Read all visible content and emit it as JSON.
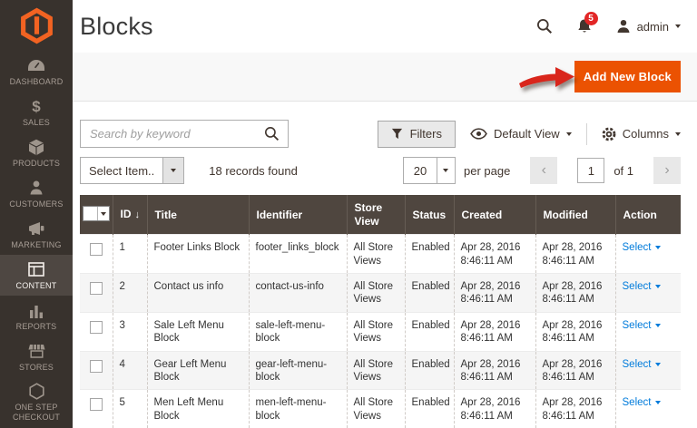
{
  "header": {
    "title": "Blocks",
    "notification_count": "5",
    "username": "admin"
  },
  "page_actions": {
    "add_new_block_label": "Add New Block"
  },
  "toolbar": {
    "search_placeholder": "Search by keyword",
    "filters_label": "Filters",
    "default_view_label": "Default View",
    "columns_label": "Columns"
  },
  "grid_controls": {
    "mass_action_label": "Select Item..",
    "records_found": "18 records found",
    "per_page_value": "20",
    "per_page_label": "per page",
    "prev_label": "‹",
    "next_label": "›",
    "current_page": "1",
    "of_pages": "of 1"
  },
  "table": {
    "header": {
      "id": "ID",
      "sort_indicator": "↓",
      "title": "Title",
      "identifier": "Identifier",
      "store_view": "Store View",
      "status": "Status",
      "created": "Created",
      "modified": "Modified",
      "action": "Action"
    },
    "rows": [
      {
        "id": "1",
        "title": "Footer Links Block",
        "identifier": "footer_links_block",
        "store_view": "All Store Views",
        "status": "Enabled",
        "created_date": "Apr 28, 2016",
        "created_time": "8:46:11 AM",
        "modified_date": "Apr 28, 2016",
        "modified_time": "8:46:11 AM",
        "action": "Select"
      },
      {
        "id": "2",
        "title": "Contact us info",
        "identifier": "contact-us-info",
        "store_view": "All Store Views",
        "status": "Enabled",
        "created_date": "Apr 28, 2016",
        "created_time": "8:46:11 AM",
        "modified_date": "Apr 28, 2016",
        "modified_time": "8:46:11 AM",
        "action": "Select"
      },
      {
        "id": "3",
        "title": "Sale Left Menu Block",
        "identifier": "sale-left-menu-block",
        "store_view": "All Store Views",
        "status": "Enabled",
        "created_date": "Apr 28, 2016",
        "created_time": "8:46:11 AM",
        "modified_date": "Apr 28, 2016",
        "modified_time": "8:46:11 AM",
        "action": "Select"
      },
      {
        "id": "4",
        "title": "Gear Left Menu Block",
        "identifier": "gear-left-menu-block",
        "store_view": "All Store Views",
        "status": "Enabled",
        "created_date": "Apr 28, 2016",
        "created_time": "8:46:11 AM",
        "modified_date": "Apr 28, 2016",
        "modified_time": "8:46:11 AM",
        "action": "Select"
      },
      {
        "id": "5",
        "title": "Men Left Menu Block",
        "identifier": "men-left-menu-block",
        "store_view": "All Store Views",
        "status": "Enabled",
        "created_date": "Apr 28, 2016",
        "created_time": "8:46:11 AM",
        "modified_date": "Apr 28, 2016",
        "modified_time": "8:46:11 AM",
        "action": "Select"
      }
    ]
  },
  "sidebar": {
    "items": [
      {
        "label": "DASHBOARD",
        "icon": "dashboard",
        "active": false
      },
      {
        "label": "SALES",
        "icon": "sales",
        "active": false
      },
      {
        "label": "PRODUCTS",
        "icon": "products",
        "active": false
      },
      {
        "label": "CUSTOMERS",
        "icon": "customers",
        "active": false
      },
      {
        "label": "MARKETING",
        "icon": "marketing",
        "active": false
      },
      {
        "label": "CONTENT",
        "icon": "content",
        "active": true
      },
      {
        "label": "REPORTS",
        "icon": "reports",
        "active": false
      },
      {
        "label": "STORES",
        "icon": "stores",
        "active": false
      },
      {
        "label": "ONE STEP CHECKOUT",
        "icon": "checkout",
        "active": false
      }
    ]
  },
  "colors": {
    "brand_orange": "#eb5202",
    "logo_orange": "#f26322",
    "badge_red": "#e22626",
    "link_blue": "#007bdb",
    "annotation_arrow_red": "#d9261c",
    "sidebar_bg": "#38322d",
    "sidebar_active_bg": "#4e4742",
    "table_header_bg": "#4f463f"
  }
}
